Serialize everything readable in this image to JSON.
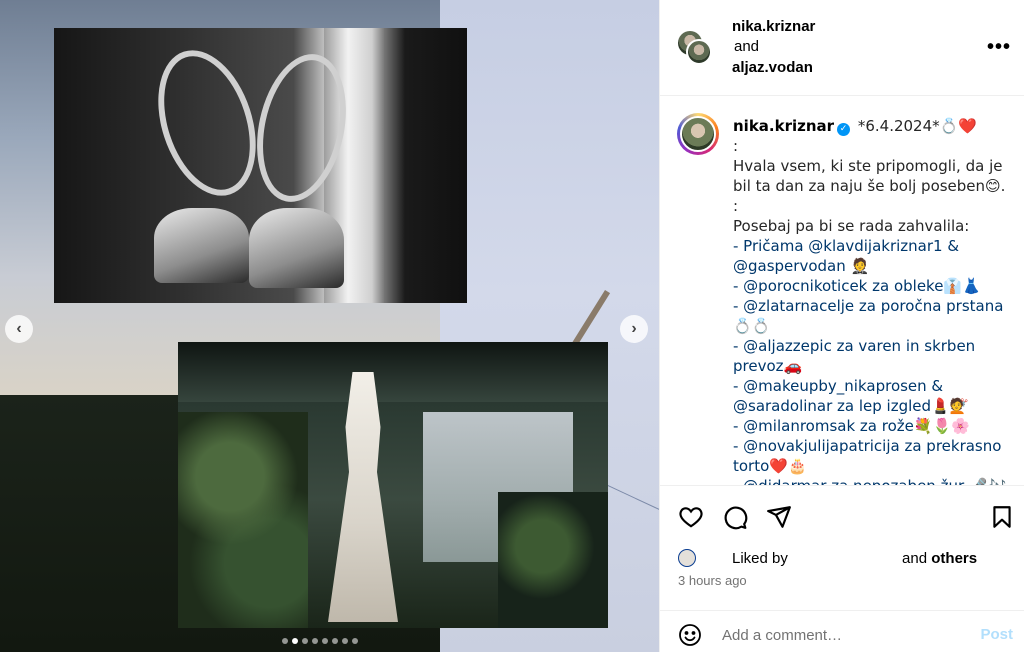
{
  "header": {
    "user1": "nika.kriznar",
    "connector": "and",
    "user2": "aljaz.vodan",
    "more_label": "•••"
  },
  "carousel": {
    "prev_icon": "‹",
    "next_icon": "›",
    "slide_count": 8,
    "active_slide": 2
  },
  "caption": {
    "username": "nika.kriznar",
    "verified_icon": "✓",
    "lines": [
      "*6.4.2024*💍❤️",
      ":",
      "Hvala vsem, ki ste pripomogli, da je bil ta dan za naju še bolj poseben😊.",
      ":",
      "Posebaj pa bi se rada zahvalila:",
      "- Pričama @klavdijakriznar1 &",
      "@gaspervodan 🤵",
      "- @porocnikoticek za obleke👔👗",
      "- @zlatarnacelje za poročna prstana 💍💍",
      "- @aljazzepic za varen in skrben prevoz🚗",
      "- @makeupby_nikaprosen &",
      "@saradolinar za lep izgled💄💇",
      "- @milanromsak za rože💐🌷🌸",
      "- @novakjulijapatricija za prekrasno torto❤️🎂",
      "- @didarmar za nepozaben žur 🎤🎶"
    ]
  },
  "likes": {
    "prefix": "Liked by",
    "suffix": "and",
    "others": "others"
  },
  "timestamp": "3 hours ago",
  "comment": {
    "emoji_icon": "☺",
    "placeholder": "Add a comment…",
    "post_label": "Post"
  }
}
